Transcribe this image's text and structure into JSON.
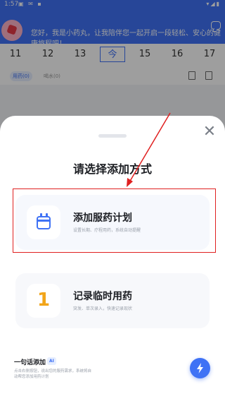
{
  "status_bar": {
    "time": "1:57",
    "left_icons": "▣ ✉ ▪",
    "right_icons": "▾◢▮"
  },
  "header": {
    "greeting": "您好，我是小药丸，让我陪伴您一起开启一段轻松、安心的健康旅程吧！"
  },
  "date_strip": {
    "dates": [
      "11",
      "12",
      "13",
      "今",
      "15",
      "16",
      "17"
    ],
    "selected": "今"
  },
  "med_tabs": {
    "tabs": [
      "用药(0)",
      "喝水(0)"
    ]
  },
  "sheet": {
    "title": "请选择添加方式",
    "close_glyph": "✕",
    "options": [
      {
        "title": "添加服药计划",
        "subtitle": "设置长期、疗程用药，系统自动提醒",
        "icon": "calendar-icon"
      },
      {
        "title": "记录临时用药",
        "subtitle": "突发、单次录入，快速记录现状",
        "icon": "number-one-icon",
        "icon_text": "1"
      }
    ],
    "quick_add": {
      "title": "一句话添加",
      "badge": "AI",
      "desc": "点击右侧按钮，说出您的服药需求，系统将自动帮您添加用药计划"
    },
    "fab_icon": "lightning-icon"
  },
  "colors": {
    "brand": "#3f72f5",
    "accent_orange": "#f2a51a",
    "highlight_red": "#e02020"
  }
}
